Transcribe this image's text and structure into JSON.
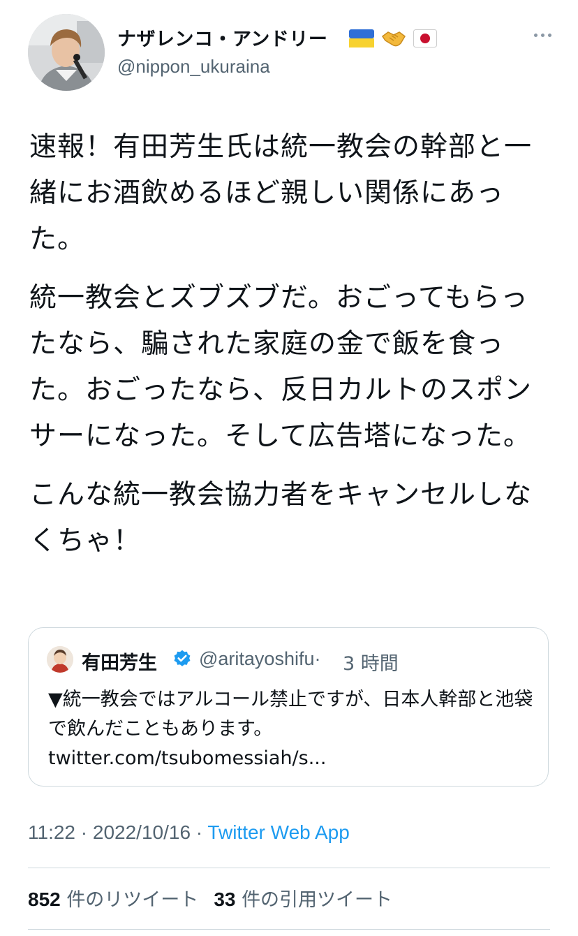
{
  "author": {
    "display_name": "ナザレンコ・アンドリー",
    "handle": "@nippon_ukuraina",
    "name_emojis": [
      "ukraine-flag-icon",
      "handshake-icon",
      "japan-flag-icon"
    ]
  },
  "tweet": {
    "paragraphs": [
      "速報！有田芳生氏は統一教会の幹部と一緒にお酒飲めるほど親しい関係にあった。",
      "統一教会とズブズブだ。おごってもらったなら、騙された家庭の金で飯を食った。おごったなら、反日カルトのスポンサーになった。そして広告塔になった。",
      "こんな統一教会協力者をキャンセルしなくちゃ！"
    ]
  },
  "quote": {
    "name": "有田芳生",
    "verified": true,
    "handle": "@aritayoshifu",
    "separator": "·",
    "time": "3 時間",
    "text": "▼統一教会ではアルコール禁止ですが、日本人幹部と池袋で飲んだこともあります。 twitter.com/tsubomessiah/s..."
  },
  "meta": {
    "time": "11:22",
    "sep1": " · ",
    "date": "2022/10/16",
    "sep2": " · ",
    "source": "Twitter Web App"
  },
  "stats": {
    "retweets_count": "852",
    "retweets_label": "件のリツイート",
    "quotes_count": "33",
    "quotes_label": "件の引用ツイート"
  },
  "colors": {
    "text": "#0f1419",
    "secondary": "#536471",
    "link": "#1d9bf0",
    "border": "#cfd9de",
    "verified": "#1d9bf0"
  }
}
